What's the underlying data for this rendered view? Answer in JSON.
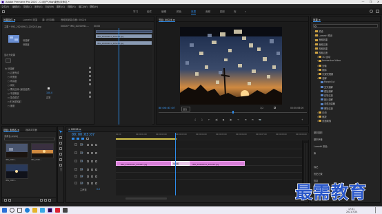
{
  "window": {
    "title": "Adobe Premiere Pro 2020 - C:\\用户\\Ybq\\桌面\\未命名 *",
    "controls": [
      "—",
      "❐",
      "✕"
    ]
  },
  "menubar": [
    "文件(F)",
    "编辑(E)",
    "剪辑(C)",
    "序列(S)",
    "标记(M)",
    "图形(G)",
    "视图(V)",
    "窗口(W)",
    "帮助(H)"
  ],
  "workspaces": [
    "学习",
    "组件",
    "编辑",
    "颜色",
    "效果",
    "音频",
    "图形",
    "库",
    "»"
  ],
  "active_workspace_index": 4,
  "effect_controls": {
    "tabs": [
      "效果控件 ≡",
      "Lumetri 范围",
      "源: (无剪辑)",
      "音频剪辑混合器: 00026"
    ],
    "active_tab": 0,
    "header_left": "主要 * IMG_20200911_205245.jpg",
    "header_right": "00026 * IMG_20200911...",
    "mini_timecode": "00:00",
    "clip_name_1": "IMG_20200911_205245.jpg",
    "clip_name_2": "IMG_20200911_205245.jpg",
    "effect_labels": [
      "块溶解",
      "块宽度",
      "块高度"
    ],
    "effect_values": [
      "",
      "",
      ""
    ],
    "opacity_section": "显示为效果",
    "props": [
      {
        "label": "○ 过渡完成",
        "value": ""
      },
      {
        "label": "○ 块宽度",
        "value": ""
      },
      {
        "label": "○ 块高度",
        "value": ""
      },
      {
        "label": "○ 羽化",
        "value": ""
      },
      {
        "label": "○ 柔化边缘 (最佳品质)",
        "value": ""
      },
      {
        "label": "○ 不透明度",
        "value": "100.0"
      },
      {
        "label": "○ 混合模式",
        "value": "正常"
      },
      {
        "label": "○ 时间重映射",
        "value": ""
      },
      {
        "label": "○ 速度",
        "value": ""
      }
    ],
    "fx_heading": "fx 块溶解"
  },
  "program_monitor": {
    "tab": "节目: 00026 ≡",
    "timecode_left": "00:00:03:07",
    "fit": "适合",
    "ratio": "1/2",
    "timecode_right": "00:00:06:00",
    "transport_buttons": [
      "{",
      "}",
      "⇤",
      "◀|",
      "▶",
      "|▶",
      "⇥",
      "⊞",
      "⊟",
      "📷",
      "+"
    ]
  },
  "effects_panel": {
    "tab": "效果 ≡",
    "search_placeholder": "",
    "tree": [
      {
        "label": "预设",
        "indent": 0,
        "folder": true
      },
      {
        "label": "Lumetri 预设",
        "indent": 0,
        "folder": true
      },
      {
        "label": "音频效果",
        "indent": 0,
        "folder": true
      },
      {
        "label": "音频过渡",
        "indent": 0,
        "folder": true
      },
      {
        "label": "视频效果",
        "indent": 0,
        "folder": true
      },
      {
        "label": "视频过渡",
        "indent": 0,
        "folder": true
      },
      {
        "label": "3D 运动",
        "indent": 1,
        "folder": true
      },
      {
        "label": "Immersive Video",
        "indent": 1,
        "folder": true
      },
      {
        "label": "划像",
        "indent": 1,
        "folder": true
      },
      {
        "label": "擦除",
        "indent": 1,
        "folder": true
      },
      {
        "label": "沉浸式视频",
        "indent": 1,
        "folder": true
      },
      {
        "label": "溶解",
        "indent": 1,
        "folder": true
      },
      {
        "label": "MorphCut",
        "indent": 2,
        "folder": false
      },
      {
        "label": "交叉溶解",
        "indent": 2,
        "folder": false
      },
      {
        "label": "叠加溶解",
        "indent": 2,
        "folder": false
      },
      {
        "label": "白场过渡",
        "indent": 2,
        "folder": false
      },
      {
        "label": "胶片溶解",
        "indent": 2,
        "folder": false
      },
      {
        "label": "非叠加溶解",
        "indent": 2,
        "folder": false
      },
      {
        "label": "黑场过渡",
        "indent": 2,
        "folder": false
      },
      {
        "label": "内滑",
        "indent": 1,
        "folder": true
      },
      {
        "label": "缩放",
        "indent": 1,
        "folder": true
      },
      {
        "label": "页面剥落",
        "indent": 1,
        "folder": true
      }
    ],
    "sections": [
      "基本图形",
      "基本声音",
      "Lumetri 颜色",
      "库",
      "标记",
      "历史记录",
      "信息"
    ]
  },
  "project_panel": {
    "tabs": [
      "项目: 未命名 ≡",
      "媒体浏览器"
    ],
    "path": "未命名.prproj",
    "items": [
      {
        "name": "IMG_2020...",
        "dur": "5:00"
      },
      {
        "name": "IMG_2020...",
        "dur": "5:00"
      },
      {
        "name": "IMG_2020...",
        "dur": "5:00"
      }
    ]
  },
  "timeline": {
    "tab": "× 00026 ≡",
    "timecode": "00:00:03:07",
    "ruler": [
      "00:00",
      "00:00:01:00",
      "00:00:02:00",
      "00:00:03:00",
      "00:00:04:00",
      "00:00:05:00",
      "00:00:06:00",
      "00:00:07:00",
      "00:00:08:00",
      "00:00:09:00"
    ],
    "tracks": [
      "V3",
      "V2",
      "V1",
      "A1",
      "A2",
      "A3"
    ],
    "master": "主声道",
    "master_value": "0.0",
    "clip1": "IMG_20200911_205245.jpg",
    "transition": "块溶解",
    "clip2": "IMG_20200911_205250.jpg"
  },
  "taskbar": {
    "time": "17:31",
    "date": "2021/7/24"
  },
  "watermark": "最需教育",
  "colors": {
    "accent": "#2d8ceb",
    "clip": "#d97fd9",
    "timecode": "#3fa0ff"
  }
}
